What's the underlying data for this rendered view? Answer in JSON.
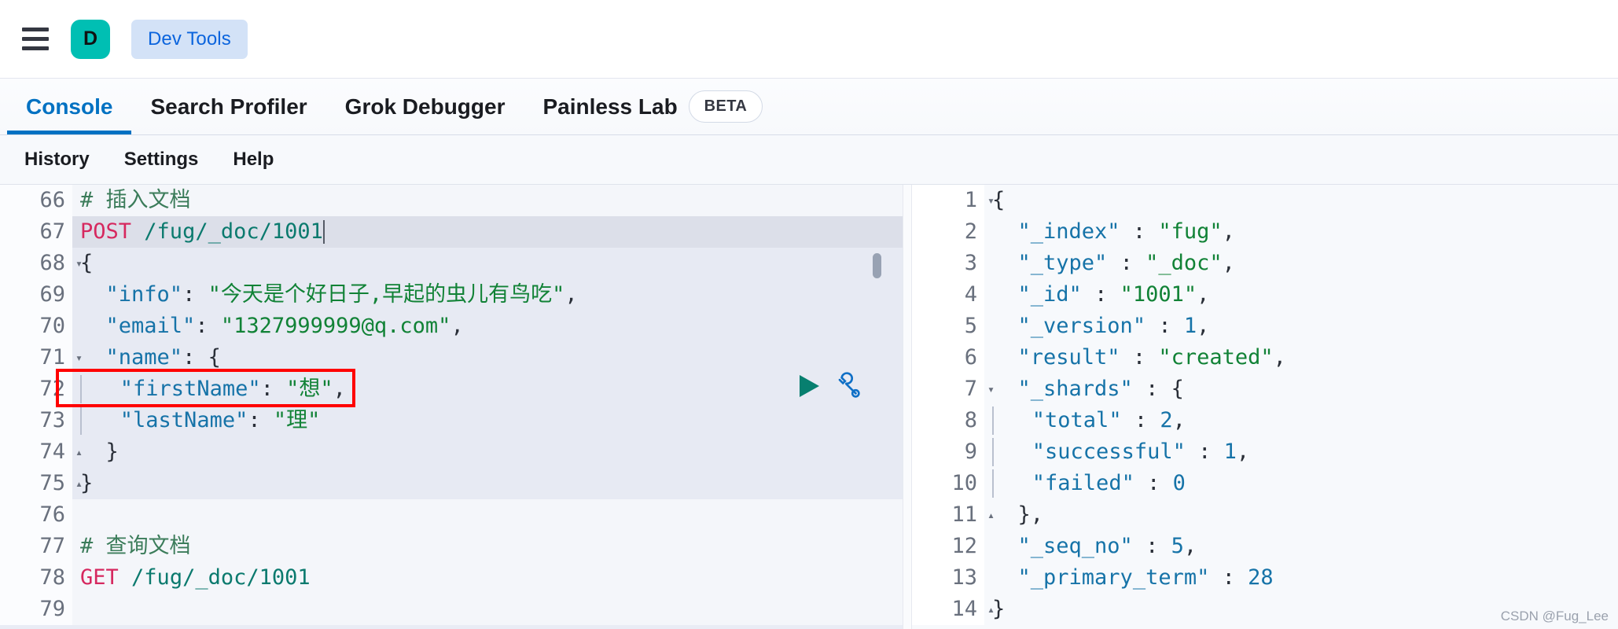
{
  "header": {
    "menu_icon": "hamburger-menu-icon",
    "avatar_letter": "D",
    "breadcrumb": "Dev Tools"
  },
  "tabs": [
    {
      "label": "Console",
      "active": true,
      "badge": null
    },
    {
      "label": "Search Profiler",
      "active": false,
      "badge": null
    },
    {
      "label": "Grok Debugger",
      "active": false,
      "badge": null
    },
    {
      "label": "Painless Lab",
      "active": false,
      "badge": "BETA"
    }
  ],
  "submenu": [
    {
      "label": "History"
    },
    {
      "label": "Settings"
    },
    {
      "label": "Help"
    }
  ],
  "editor": {
    "actions": {
      "run": "play-icon",
      "wrench": "wrench-icon"
    },
    "lines": [
      {
        "num": "66",
        "fold": "",
        "state": "plain",
        "text": "# 插入文档"
      },
      {
        "num": "67",
        "fold": "",
        "state": "cursor",
        "text": "POST /fug/_doc/1001"
      },
      {
        "num": "68",
        "fold": "down",
        "state": "inreq",
        "text": "{"
      },
      {
        "num": "69",
        "fold": "",
        "state": "inreq",
        "text": "  \"info\": \"今天是个好日子,早起的虫儿有鸟吃\","
      },
      {
        "num": "70",
        "fold": "",
        "state": "inreq",
        "text": "  \"email\": \"1327999999@q.com\","
      },
      {
        "num": "71",
        "fold": "down",
        "state": "inreq",
        "text": "  \"name\": {"
      },
      {
        "num": "72",
        "fold": "",
        "state": "inreq",
        "text": "    \"firstName\": \"想\","
      },
      {
        "num": "73",
        "fold": "",
        "state": "inreq",
        "text": "    \"lastName\": \"理\""
      },
      {
        "num": "74",
        "fold": "up",
        "state": "inreq",
        "text": "  }"
      },
      {
        "num": "75",
        "fold": "up",
        "state": "inreq",
        "text": "}"
      },
      {
        "num": "76",
        "fold": "",
        "state": "plain",
        "text": ""
      },
      {
        "num": "77",
        "fold": "",
        "state": "plain",
        "text": "# 查询文档"
      },
      {
        "num": "78",
        "fold": "",
        "state": "plain",
        "text": "GET /fug/_doc/1001"
      },
      {
        "num": "79",
        "fold": "",
        "state": "plain",
        "text": ""
      }
    ]
  },
  "response": {
    "lines": [
      {
        "num": "1",
        "fold": "down",
        "text": "{"
      },
      {
        "num": "2",
        "fold": "",
        "text": "  \"_index\" : \"fug\","
      },
      {
        "num": "3",
        "fold": "",
        "text": "  \"_type\" : \"_doc\","
      },
      {
        "num": "4",
        "fold": "",
        "text": "  \"_id\" : \"1001\","
      },
      {
        "num": "5",
        "fold": "",
        "text": "  \"_version\" : 1,"
      },
      {
        "num": "6",
        "fold": "",
        "text": "  \"result\" : \"created\","
      },
      {
        "num": "7",
        "fold": "down",
        "text": "  \"_shards\" : {"
      },
      {
        "num": "8",
        "fold": "",
        "text": "    \"total\" : 2,"
      },
      {
        "num": "9",
        "fold": "",
        "text": "    \"successful\" : 1,"
      },
      {
        "num": "10",
        "fold": "",
        "text": "    \"failed\" : 0"
      },
      {
        "num": "11",
        "fold": "up",
        "text": "  },"
      },
      {
        "num": "12",
        "fold": "",
        "text": "  \"_seq_no\" : 5,"
      },
      {
        "num": "13",
        "fold": "",
        "text": "  \"_primary_term\" : 28"
      },
      {
        "num": "14",
        "fold": "up",
        "text": "}"
      }
    ]
  },
  "annotations": {
    "request_highlight": "POST /fug/_doc/1001",
    "result_highlight": "\"created\""
  },
  "watermark": "CSDN @Fug_Lee",
  "colors": {
    "accent_blue": "#0071c2",
    "avatar_teal": "#00bfb3",
    "annotation_red": "#ff0000",
    "breadcrumb_bg": "#d3e2f7",
    "method_pink": "#d6285f",
    "string_green": "#118236",
    "key_blue": "#1673a8"
  }
}
